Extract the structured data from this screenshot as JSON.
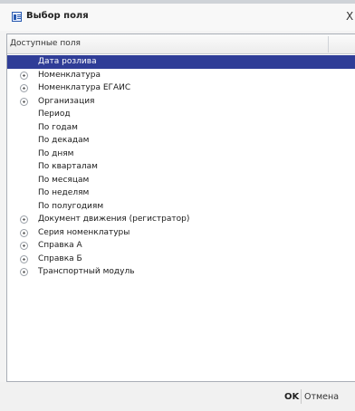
{
  "window": {
    "title": "Выбор поля",
    "close_label": "X"
  },
  "panel": {
    "header": "Доступные поля"
  },
  "fields": [
    {
      "label": "Дата розлива",
      "expandable": false,
      "selected": true
    },
    {
      "label": "Номенклатура",
      "expandable": true,
      "selected": false
    },
    {
      "label": "Номенклатура ЕГАИС",
      "expandable": true,
      "selected": false
    },
    {
      "label": "Организация",
      "expandable": true,
      "selected": false
    },
    {
      "label": "Период",
      "expandable": false,
      "selected": false
    },
    {
      "label": "По годам",
      "expandable": false,
      "selected": false
    },
    {
      "label": "По декадам",
      "expandable": false,
      "selected": false
    },
    {
      "label": "По дням",
      "expandable": false,
      "selected": false
    },
    {
      "label": "По кварталам",
      "expandable": false,
      "selected": false
    },
    {
      "label": "По месяцам",
      "expandable": false,
      "selected": false
    },
    {
      "label": "По неделям",
      "expandable": false,
      "selected": false
    },
    {
      "label": "По полугодиям",
      "expandable": false,
      "selected": false
    },
    {
      "label": "Документ движения (регистратор)",
      "expandable": true,
      "selected": false
    },
    {
      "label": "Серия номенклатуры",
      "expandable": true,
      "selected": false
    },
    {
      "label": "Справка А",
      "expandable": true,
      "selected": false
    },
    {
      "label": "Справка Б",
      "expandable": true,
      "selected": false
    },
    {
      "label": "Транспортный модуль",
      "expandable": true,
      "selected": false
    }
  ],
  "footer": {
    "ok_label": "OK",
    "cancel_label": "Отмена"
  },
  "colors": {
    "selection": "#2f3d97",
    "selection_text": "#ffffff"
  }
}
